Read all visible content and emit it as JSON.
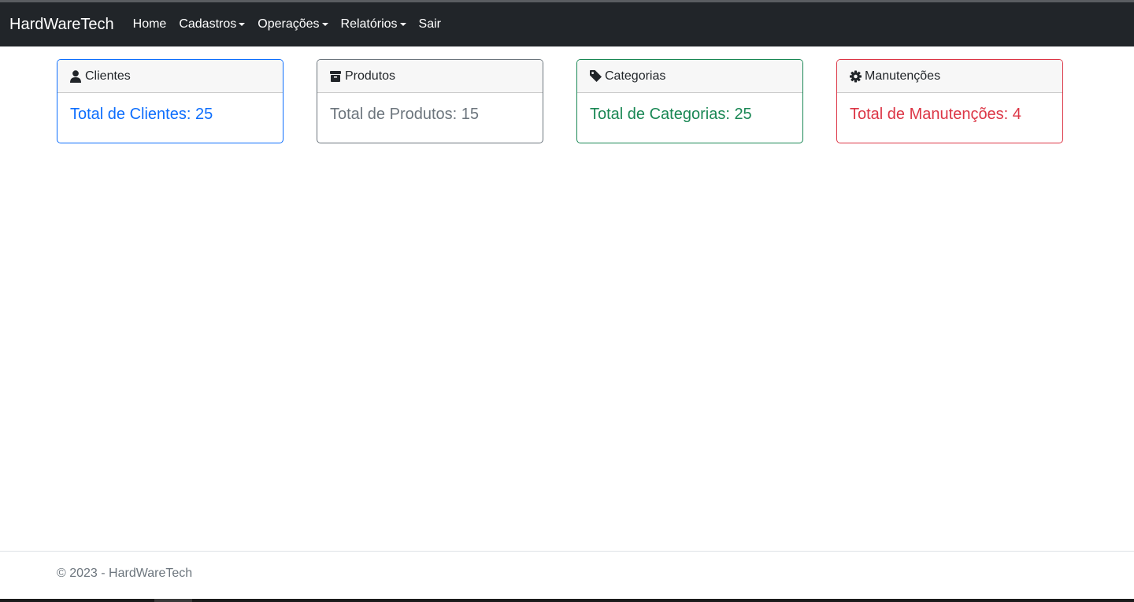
{
  "navbar": {
    "brand": "HardWareTech",
    "items": [
      {
        "label": "Home",
        "dropdown": false
      },
      {
        "label": "Cadastros",
        "dropdown": true
      },
      {
        "label": "Operações",
        "dropdown": true
      },
      {
        "label": "Relatórios",
        "dropdown": true
      },
      {
        "label": "Sair",
        "dropdown": false
      }
    ]
  },
  "cards": [
    {
      "title": "Clientes",
      "icon": "user-icon",
      "text": "Total de Clientes: 25",
      "color": "#0d6efd"
    },
    {
      "title": "Produtos",
      "icon": "box-icon",
      "text": "Total de Produtos: 15",
      "color": "#6c757d"
    },
    {
      "title": "Categorias",
      "icon": "tag-icon",
      "text": "Total de Categorias: 25",
      "color": "#198754"
    },
    {
      "title": "Manutenções",
      "icon": "gear-icon",
      "text": "Total de Manutenções: 4",
      "color": "#dc3545"
    }
  ],
  "footer": {
    "text": "© 2023 - HardWareTech"
  }
}
